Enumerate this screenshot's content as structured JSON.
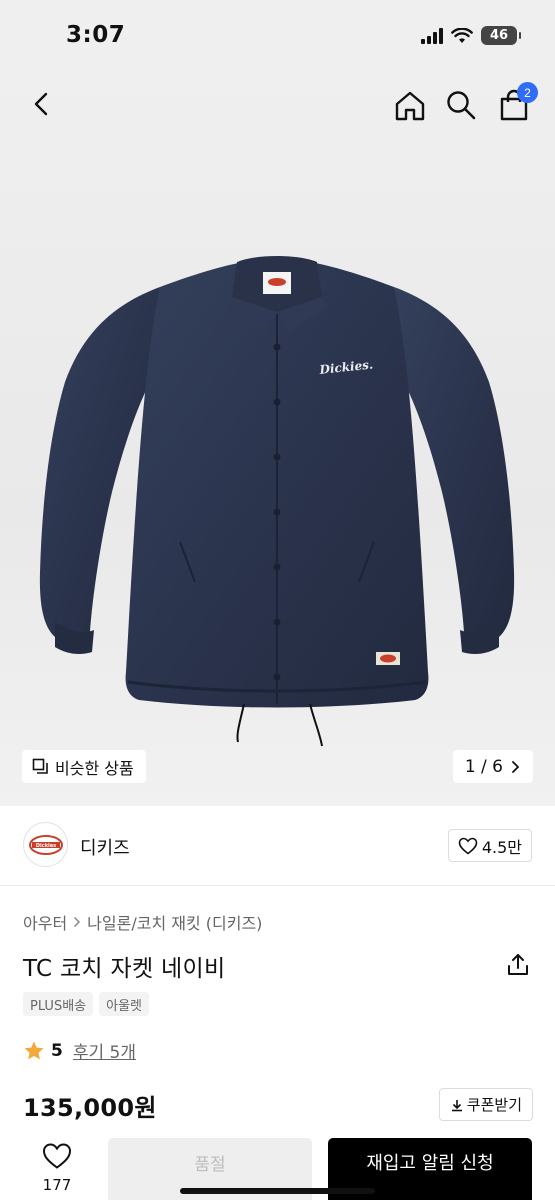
{
  "status": {
    "time": "3:07",
    "network": "46"
  },
  "header": {
    "cart_count": "2"
  },
  "gallery": {
    "similar_label": "비슷한 상품",
    "counter": "1 / 6"
  },
  "jacket_logo_text": "Dickies.",
  "brand": {
    "name": "디키즈",
    "like_count": "4.5만",
    "logo_text": "Dickies"
  },
  "breadcrumb": [
    "아우터",
    "나일론/코치 재킷 (디키즈)"
  ],
  "product": {
    "title": "TC 코치 자켓 네이비",
    "tags": [
      "PLUS배송",
      "아울렛"
    ],
    "rating": "5",
    "reviews": "후기 5개",
    "price": "135,000원",
    "coupon_label": "쿠폰받기"
  },
  "bottom": {
    "wish_count": "177",
    "soldout_label": "품절",
    "restock_label": "재입고 알림 신청"
  },
  "colors": {
    "accent": "#2f6df6",
    "jacket": "#2c3650",
    "star": "#f2a93b"
  }
}
